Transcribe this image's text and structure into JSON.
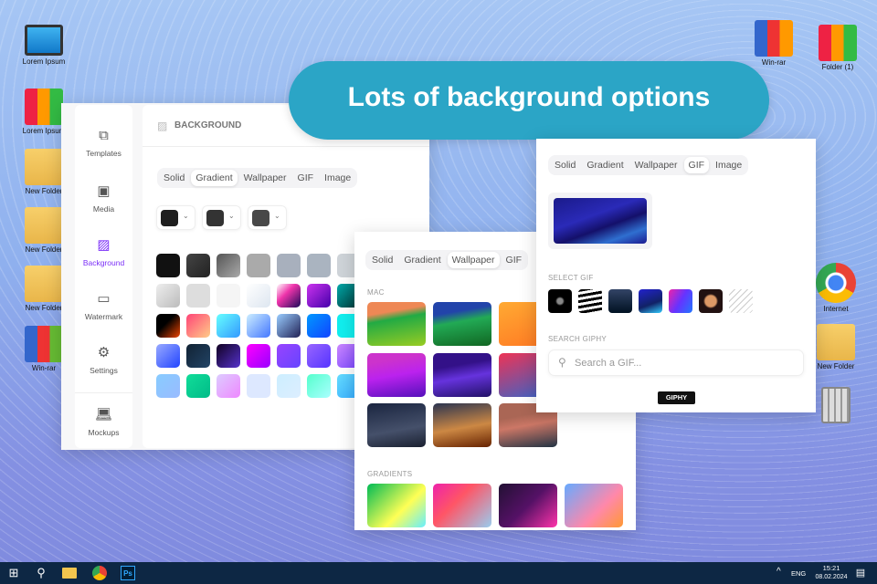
{
  "banner": {
    "text": "Lots of background options",
    "color": "#2ba5c6"
  },
  "desktop": {
    "left": [
      "Lorem Ipsum",
      "Lorem Ipsum",
      "New Folder",
      "New Folder",
      "New Folder",
      "Win-rar"
    ],
    "right": [
      "Win-rar",
      "Folder (1)",
      "Internet",
      "New Folder"
    ]
  },
  "editor": {
    "sidebar": [
      {
        "label": "Templates",
        "icon": "template-icon"
      },
      {
        "label": "Media",
        "icon": "media-icon"
      },
      {
        "label": "Background",
        "icon": "background-icon",
        "active": true
      },
      {
        "label": "Watermark",
        "icon": "watermark-icon"
      },
      {
        "label": "Settings",
        "icon": "gear-icon"
      },
      {
        "label": "Mockups",
        "icon": "laptop-icon"
      }
    ],
    "title": "BACKGROUND",
    "tabs": [
      "Solid",
      "Gradient",
      "Wallpaper",
      "GIF",
      "Image"
    ],
    "active_tab": "Gradient",
    "colors": [
      "#1e1e1e",
      "#333333",
      "#484848"
    ],
    "accent": "#7b2ff7"
  },
  "wallpaper_panel": {
    "tabs": [
      "Solid",
      "Gradient",
      "Wallpaper",
      "GIF"
    ],
    "active_tab": "Wallpaper",
    "mac_label": "MAC",
    "gradients_label": "GRADIENTS"
  },
  "gif_panel": {
    "tabs": [
      "Solid",
      "Gradient",
      "Wallpaper",
      "GIF",
      "Image"
    ],
    "active_tab": "GIF",
    "select_label": "SELECT GIF",
    "search_label": "SEARCH GIPHY",
    "search_placeholder": "Search a GIF...",
    "giphy": "GIPHY"
  },
  "taskbar": {
    "lang": "ENG",
    "time": "15:21",
    "date": "08.02.2024"
  }
}
